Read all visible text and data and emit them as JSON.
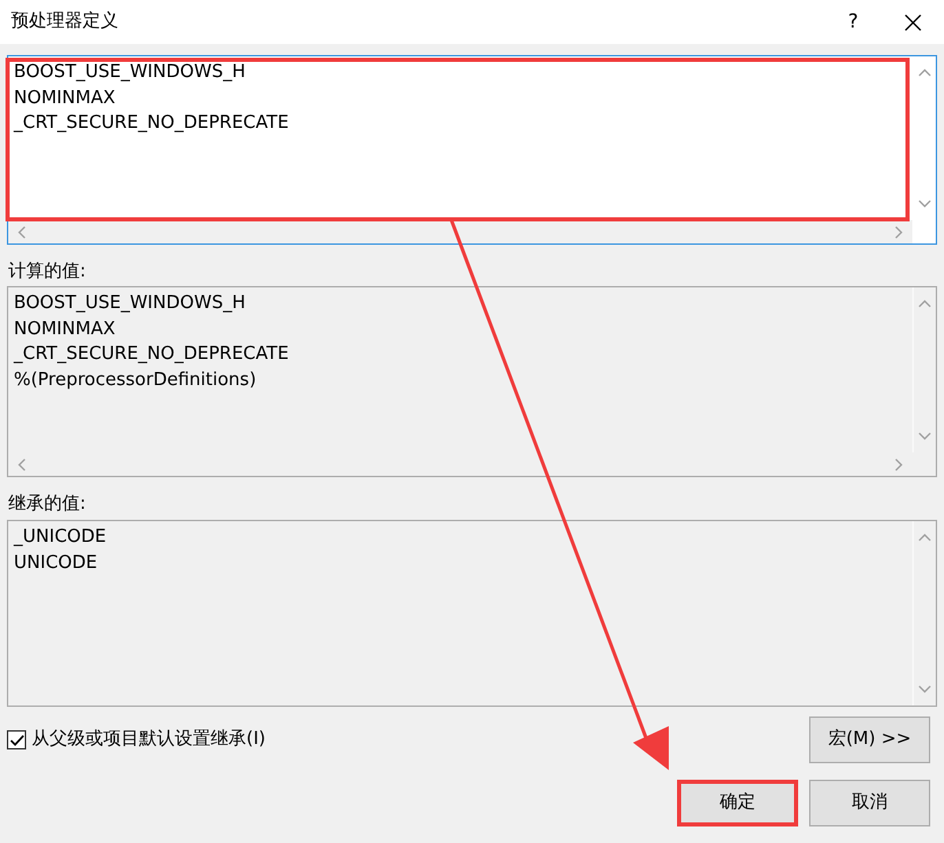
{
  "window": {
    "title": "预处理器定义",
    "help": "?"
  },
  "definitions": {
    "lines": [
      "BOOST_USE_WINDOWS_H",
      "NOMINMAX",
      "_CRT_SECURE_NO_DEPRECATE"
    ],
    "highlighted": true
  },
  "evaluated": {
    "label": "计算的值:",
    "lines": [
      "BOOST_USE_WINDOWS_H",
      "NOMINMAX",
      "_CRT_SECURE_NO_DEPRECATE",
      "%(PreprocessorDefinitions)"
    ]
  },
  "inherited": {
    "label": "继承的值:",
    "lines": [
      "_UNICODE",
      "UNICODE"
    ]
  },
  "inherit_checkbox": {
    "label": "从父级或项目默认设置继承(I)",
    "checked": true
  },
  "macro_button": "宏(M) >>",
  "buttons": [
    {
      "label": "确定",
      "highlighted": true
    },
    {
      "label": "取消",
      "highlighted": false
    }
  ]
}
